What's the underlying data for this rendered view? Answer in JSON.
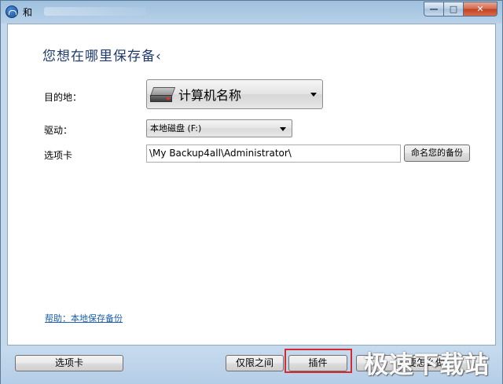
{
  "window": {
    "title": "和",
    "minimize": "—",
    "maximize": "□",
    "close": "✕"
  },
  "main": {
    "heading": "您想在哪里保存备‹",
    "destination_label": "目的地：",
    "destination_value": "计算机名称",
    "drive_label": "驱动：",
    "drive_value": "本地磁盘 (F:)",
    "tab_label": "选项卡",
    "path_value": "\\My Backup4all\\Administrator\\",
    "name_button": "命名您的备份",
    "help_link": "帮助：本地保存备份"
  },
  "footer": {
    "tab_button": "选项卡",
    "prev_button": "仅限之间",
    "next_button": "插件",
    "finish_button": "您要怎么做",
    "watermark": "极速下载站"
  },
  "colors": {
    "heading": "#1f3b6b",
    "link": "#1a5fb4",
    "highlight": "#d62b2b"
  }
}
